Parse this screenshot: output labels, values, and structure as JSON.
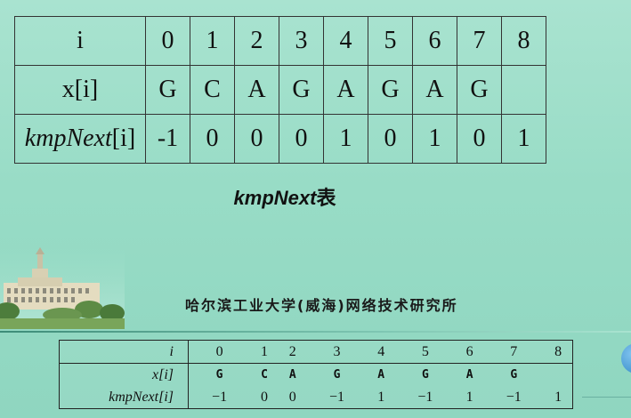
{
  "main_table": {
    "header": "i",
    "indices": [
      "0",
      "1",
      "2",
      "3",
      "4",
      "5",
      "6",
      "7",
      "8"
    ],
    "x_label": "x[i]",
    "x_values": [
      "G",
      "C",
      "A",
      "G",
      "A",
      "G",
      "A",
      "G",
      ""
    ],
    "kmp_label_italic": "kmpNext",
    "kmp_label_suffix": "[i]",
    "kmp_values": [
      "-1",
      "0",
      "0",
      "0",
      "1",
      "0",
      "1",
      "0",
      "1"
    ]
  },
  "caption": {
    "italic": "kmpNext",
    "suffix": "表"
  },
  "institute": "哈尔滨工业大学(威海)网络技术研究所",
  "small_table": {
    "header": "i",
    "indices": [
      "0",
      "1",
      "2",
      "3",
      "4",
      "5",
      "6",
      "7",
      "8"
    ],
    "x_label": "x[i]",
    "x_values": [
      "G",
      "C",
      "A",
      "G",
      "A",
      "G",
      "A",
      "G",
      ""
    ],
    "kmp_label": "kmpNext[i]",
    "kmp_values": [
      "−1",
      "0",
      "0",
      "−1",
      "1",
      "−1",
      "1",
      "−1",
      "1"
    ]
  }
}
